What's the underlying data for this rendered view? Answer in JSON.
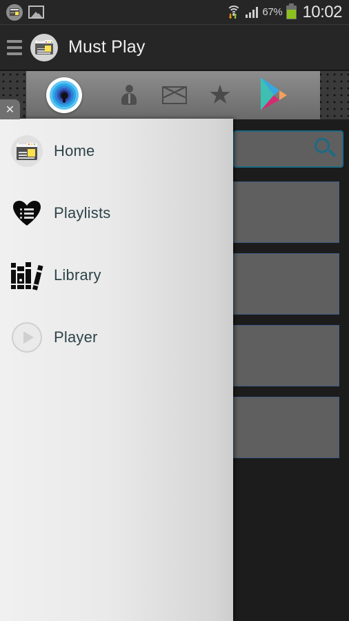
{
  "status_bar": {
    "notification_icons": [
      "app-window-icon",
      "gallery-image-icon"
    ],
    "wifi_icon": "wifi-icon",
    "signal_icon": "cell-signal-icon",
    "battery_percent": "67%",
    "battery_icon": "battery-icon",
    "time": "10:02"
  },
  "action_bar": {
    "menu_icon": "hamburger-menu-icon",
    "app_icon": "app-logo-icon",
    "title": "Must Play"
  },
  "ad_banner": {
    "close_label": "✕",
    "brand_icon": "1password-lock-icon",
    "icons": [
      "person-icon",
      "envelope-icon",
      "star-icon"
    ],
    "star_glyph": "★",
    "store_icon": "google-play-icon"
  },
  "drawer": {
    "items": [
      {
        "label": "Home",
        "icon": "home-window-icon"
      },
      {
        "label": "Playlists",
        "icon": "heart-list-icon"
      },
      {
        "label": "Library",
        "icon": "books-icon"
      },
      {
        "label": "Player",
        "icon": "play-circle-icon"
      }
    ]
  },
  "content": {
    "search_icon": "search-magnifier-icon",
    "cards": [
      {
        "name": "content-card-1"
      },
      {
        "name": "content-card-2"
      },
      {
        "name": "content-card-3"
      },
      {
        "name": "content-card-4"
      }
    ]
  },
  "colors": {
    "accent_teal": "#1c6a86",
    "drawer_text": "#2d4349",
    "card_border": "#3f5d86",
    "card_fill": "#5f5f5f",
    "battery_green": "#8ac11c"
  }
}
